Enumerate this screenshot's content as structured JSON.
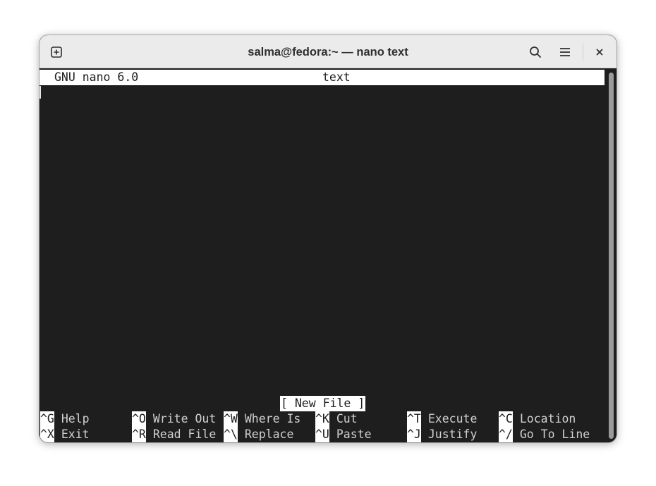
{
  "window": {
    "title": "salma@fedora:~ — nano text"
  },
  "icons": {
    "new_tab": "new-tab-icon",
    "search": "search-icon",
    "menu": "hamburger-menu-icon",
    "close": "close-icon"
  },
  "nano": {
    "version": "GNU nano 6.0",
    "filename": "text",
    "status": "[ New File ]",
    "shortcuts_row1": [
      {
        "key": "^G",
        "label": "Help"
      },
      {
        "key": "^O",
        "label": "Write Out"
      },
      {
        "key": "^W",
        "label": "Where Is"
      },
      {
        "key": "^K",
        "label": "Cut"
      },
      {
        "key": "^T",
        "label": "Execute"
      },
      {
        "key": "^C",
        "label": "Location"
      }
    ],
    "shortcuts_row2": [
      {
        "key": "^X",
        "label": "Exit"
      },
      {
        "key": "^R",
        "label": "Read File"
      },
      {
        "key": "^\\",
        "label": "Replace"
      },
      {
        "key": "^U",
        "label": "Paste"
      },
      {
        "key": "^J",
        "label": "Justify"
      },
      {
        "key": "^/",
        "label": "Go To Line"
      }
    ]
  },
  "colors": {
    "terminal_bg": "#1e1e1e",
    "terminal_fg": "#d0d0d0",
    "titlebar_bg": "#ebebeb",
    "inverse_bg": "#ffffff"
  }
}
